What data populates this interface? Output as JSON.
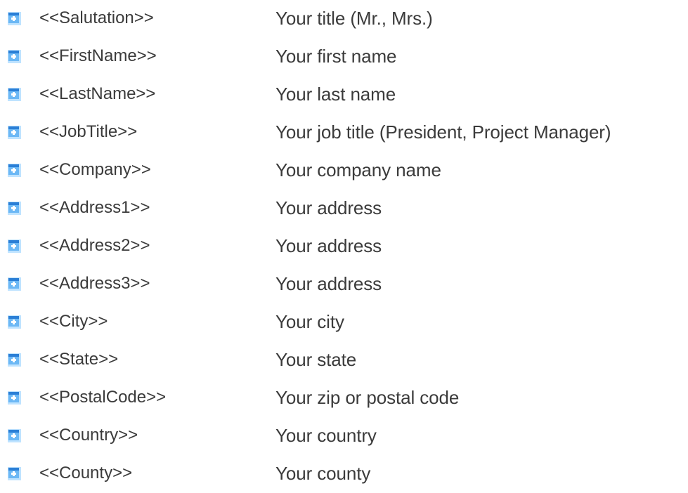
{
  "fields": [
    {
      "token": "<<Salutation>>",
      "description": "Your title (Mr., Mrs.)"
    },
    {
      "token": "<<FirstName>>",
      "description": "Your first name"
    },
    {
      "token": "<<LastName>>",
      "description": "Your last name"
    },
    {
      "token": "<<JobTitle>>",
      "description": "Your job title (President, Project Manager)"
    },
    {
      "token": "<<Company>>",
      "description": "Your company name"
    },
    {
      "token": "<<Address1>>",
      "description": "Your address"
    },
    {
      "token": "<<Address2>>",
      "description": "Your address"
    },
    {
      "token": "<<Address3>>",
      "description": "Your address"
    },
    {
      "token": "<<City>>",
      "description": "Your city"
    },
    {
      "token": "<<State>>",
      "description": "Your state"
    },
    {
      "token": "<<PostalCode>>",
      "description": "Your zip or postal code"
    },
    {
      "token": "<<Country>>",
      "description": "Your country"
    },
    {
      "token": "<<County>>",
      "description": "Your county"
    }
  ],
  "icon": {
    "name": "list-bullet-icon",
    "color_light": "#bfe3ff",
    "color_mid": "#6cb8f5",
    "color_dark": "#2b7fd6"
  }
}
